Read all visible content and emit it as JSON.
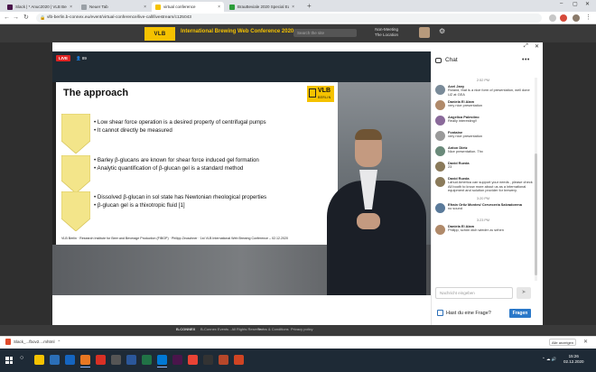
{
  "browser": {
    "tabs": [
      {
        "label": "Slack | * Anuc2020 | VLB Berlin",
        "favicon_color": "#4a154b",
        "active": false
      },
      {
        "label": "Neuer Tab",
        "favicon_color": "#9aa0a6",
        "active": false
      },
      {
        "label": "virtual conference",
        "favicon_color": "#f5c200",
        "active": true
      },
      {
        "label": "BrauBeviale 2020 Special Edition",
        "favicon_color": "#2d9d3a",
        "active": false
      }
    ],
    "url": "vlb-berlin.b-connex.eu/event/virtual-conference/live-call/livestream/c125043"
  },
  "site": {
    "logo": "VLB",
    "title": "International Brewing Web Conference 2020",
    "search_placeholder": "Search the site",
    "user_line1": "Non-Meeting",
    "user_line2": "The Location"
  },
  "video": {
    "live_label": "LIVE",
    "viewer_count": "89",
    "slide": {
      "title": "The approach",
      "logo_line1": "VLB",
      "logo_line2": "BERLIN",
      "groups": [
        {
          "bullets": [
            "Low shear force operation is a desired property of centrifugal pumps",
            "It cannot directly be measured"
          ]
        },
        {
          "bullets": [
            "Barley β-glucans are known for shear force induced gel formation",
            "Analytic quantification of β-glucan gel is a standard method"
          ]
        },
        {
          "bullets": [
            "Dissolved β-glucan in sol state has Newtonian rheological properties",
            "β-glucan gel is a thixotropic fluid [1]"
          ]
        }
      ],
      "footer": "VLB Berlin · Research Institute for Beer and Beverage Production (FIBGP) · Philipp Zeuschner · 1st VLB International Web Brewing Conference – 02.12.2020"
    }
  },
  "chat": {
    "title": "Chat",
    "messages": [
      {
        "type": "time",
        "text": "2:52 PM"
      },
      {
        "type": "msg",
        "name": "Axel Jany",
        "text": "Roland, that is a nice form of presentation, well done UZ at GEA",
        "avatar": "#7a8b99"
      },
      {
        "type": "msg",
        "name": "Daniela El Alam",
        "text": "very nice presentation",
        "avatar": "#b08a6a"
      },
      {
        "type": "msg",
        "name": "Angelica Palestino",
        "text": "Really interesting!!",
        "avatar": "#8a6a9a"
      },
      {
        "type": "msg",
        "name": "Fontaine",
        "text": "very nice presentation",
        "avatar": "#9a9a9a"
      },
      {
        "type": "msg",
        "name": "Anton Dietz",
        "text": "Nice presentation. Thx",
        "avatar": "#6a8a7a"
      },
      {
        "type": "msg",
        "name": "David Rueda",
        "text": "23",
        "avatar": "#8a7a5a"
      },
      {
        "type": "msg",
        "name": "David Rueda",
        "text": "Lahud America can support your needs , please check All booth to know more about us as a international equipment and solution provider for brewery.",
        "avatar": "#8a7a5a"
      },
      {
        "type": "time",
        "text": "3:20 PM"
      },
      {
        "type": "msg",
        "name": "Efrain Ortiz Montes/ Cerveceria Salvadorena",
        "text": "no sound",
        "avatar": "#5a7a9a"
      },
      {
        "type": "time",
        "text": "3:23 PM"
      },
      {
        "type": "msg",
        "name": "Daniela El Alam",
        "text": "Philipp, schön dich wieder zu sehen",
        "avatar": "#b08a6a"
      }
    ],
    "input_placeholder": "Nachricht eingeben",
    "question_text": "Hast du eine Frage?",
    "question_button": "Fragen"
  },
  "site_footer": {
    "brand": "B-CONNEX",
    "copyright": "B-Connex Events - All Rights Reserved",
    "terms": "Terms & Conditions",
    "privacy": "Privacy policy"
  },
  "downloads": {
    "file": "Slack_...fbov2....mhtml",
    "show_all": "Alle anzeigen"
  },
  "taskbar": {
    "items": [
      {
        "label": "",
        "color": "#f5c200"
      },
      {
        "label": "",
        "color": "#2b6fb8"
      },
      {
        "label": "",
        "color": "#1565c0"
      },
      {
        "label": "",
        "color": "#e87722"
      },
      {
        "label": "",
        "color": "#d93025"
      },
      {
        "label": "",
        "color": "#555555"
      },
      {
        "label": "",
        "color": "#2b579a"
      },
      {
        "label": "",
        "color": "#217346"
      },
      {
        "label": "",
        "color": "#0078d4"
      },
      {
        "label": "",
        "color": "#4a154b"
      },
      {
        "label": "",
        "color": "#ea4335"
      },
      {
        "label": "",
        "color": "#333333"
      },
      {
        "label": "",
        "color": "#b7472a"
      },
      {
        "label": "",
        "color": "#d04423"
      }
    ],
    "time": "15:26",
    "date": "02.12.2020"
  }
}
